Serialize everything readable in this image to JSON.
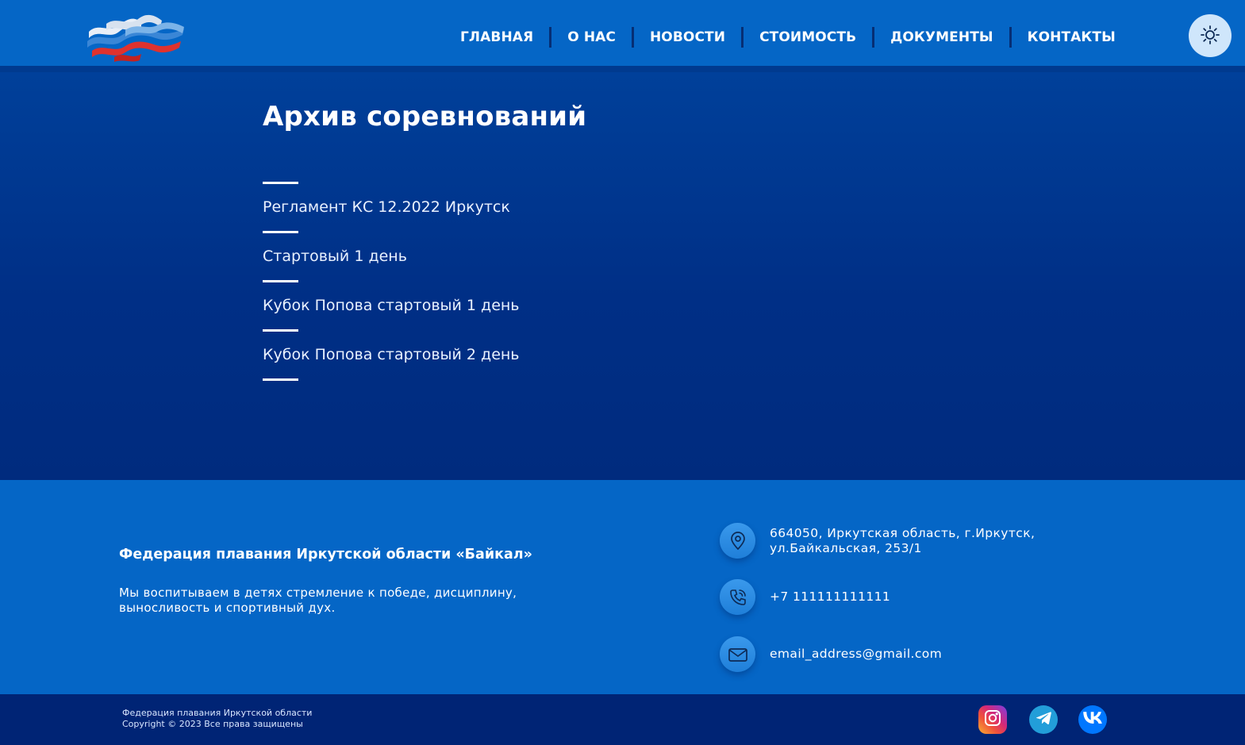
{
  "nav": {
    "items": [
      "ГЛАВНАЯ",
      "О НАС",
      "НОВОСТИ",
      "СТОИМОСТЬ",
      "ДОКУМЕНТЫ",
      "КОНТАКТЫ"
    ]
  },
  "main": {
    "title": "Архив соревнований",
    "archive": [
      "Регламент КС 12.2022 Иркутск",
      "Стартовый 1 день",
      "Кубок Попова стартовый 1 день",
      "Кубок Попова стартовый 2 день"
    ]
  },
  "footer": {
    "org_name": "Федерация плавания Иркутской области «Байкал»",
    "description": "Мы воспитываем в детях стремление к победе, дисциплину, выносливость и спортивный дух.",
    "address_line1": "664050, Иркутская область, г.Иркутск,",
    "address_line2": "ул.Байкальская, 253/1",
    "phone": "+7 111111111111",
    "email": "email_address@gmail.com",
    "copyright_line1": "Федерация плавания Иркутской области",
    "copyright_line2": "Copyright © 2023 Все права защищены"
  },
  "icons": {
    "theme": "sun-icon",
    "address": "location-pin-icon",
    "phone": "phone-icon",
    "email": "mail-icon",
    "social": [
      "instagram-icon",
      "telegram-icon",
      "vk-icon"
    ]
  },
  "colors": {
    "header": "#0566c6",
    "main_bg": "#003a8f",
    "footer": "#0566c6",
    "bottom_bar": "#002475"
  }
}
